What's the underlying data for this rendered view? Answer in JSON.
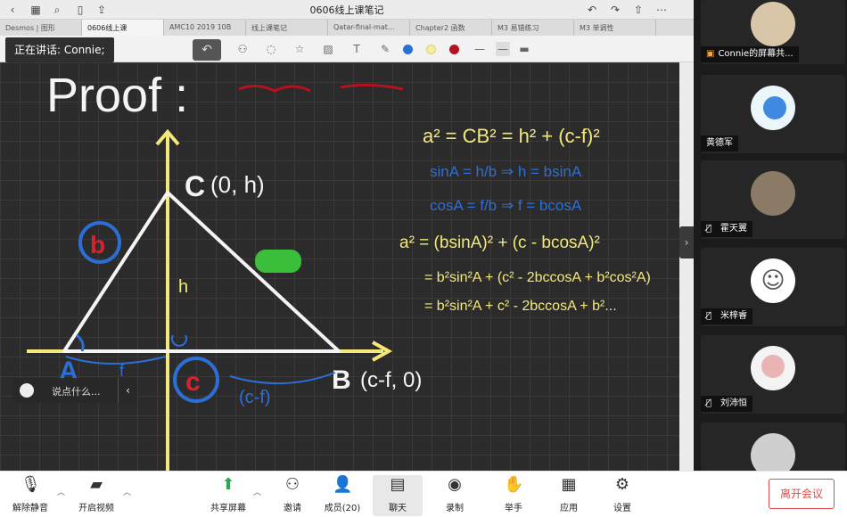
{
  "app": {
    "doc_title": "0606线上课笔记",
    "doc_tabs": [
      "Desmos | 图形",
      "0606线上课",
      "AMC10 2019 10B",
      "线上课笔记",
      "Qatar-final-mat...",
      "Chapter2 函数",
      "M3 易错练习",
      "M3 单调性"
    ],
    "speaking_label": "正在讲话: Connie;"
  },
  "colors": {
    "board_bg": "#2c2b2b",
    "chalk_white": "#f4f4f4",
    "chalk_yellow": "#f3e97a",
    "ink_blue": "#2b6fd6",
    "ink_red": "#d6232f",
    "ink_green": "#3bbf3b",
    "accent_red": "#e04a4a"
  },
  "board": {
    "title": "Proof :",
    "vertex_c": "C",
    "vertex_c_coord": "(0, h)",
    "vertex_a": "A",
    "vertex_b": "B",
    "vertex_b_coord": "(c-f, 0)",
    "height_label": "h",
    "side_b": "b",
    "side_c": "c",
    "segment_f": "f",
    "segment_cf": "(c-f)",
    "eq1": "a² = CB² = h² + (c-f)²",
    "eq2": "sinA = h/b  ⇒  h = bsinA",
    "eq3": "cosA = f/b  ⇒  f = bcosA",
    "eq4": "a² = (bsinA)² + (c - bcosA)²",
    "eq5": "= b²sin²A + (c² - 2bccosA + b²cos²A)",
    "eq6": "= b²sin²A + c² - 2bccosA + b²..."
  },
  "chat_hint": {
    "placeholder": "说点什么..."
  },
  "participants": [
    {
      "name": "Connie的屏幕共...",
      "avatar": "user-avatar-icon"
    },
    {
      "name": "黄德军",
      "avatar": "snail-avatar-icon",
      "muted": false
    },
    {
      "name": "霍天翼",
      "avatar": "cat-avatar-icon",
      "muted": true
    },
    {
      "name": "米梓睿",
      "avatar": "smiley-avatar-icon",
      "muted": true
    },
    {
      "name": "刘沛恒",
      "avatar": "monkey-avatar-icon",
      "muted": true
    }
  ],
  "controls": {
    "unmute": "解除静音",
    "start_video": "开启视频",
    "share_screen": "共享屏幕",
    "invite": "邀请",
    "members": "成员(20)",
    "chat": "聊天",
    "record": "录制",
    "raise_hand": "举手",
    "apps": "应用",
    "settings": "设置",
    "leave": "离开会议"
  }
}
